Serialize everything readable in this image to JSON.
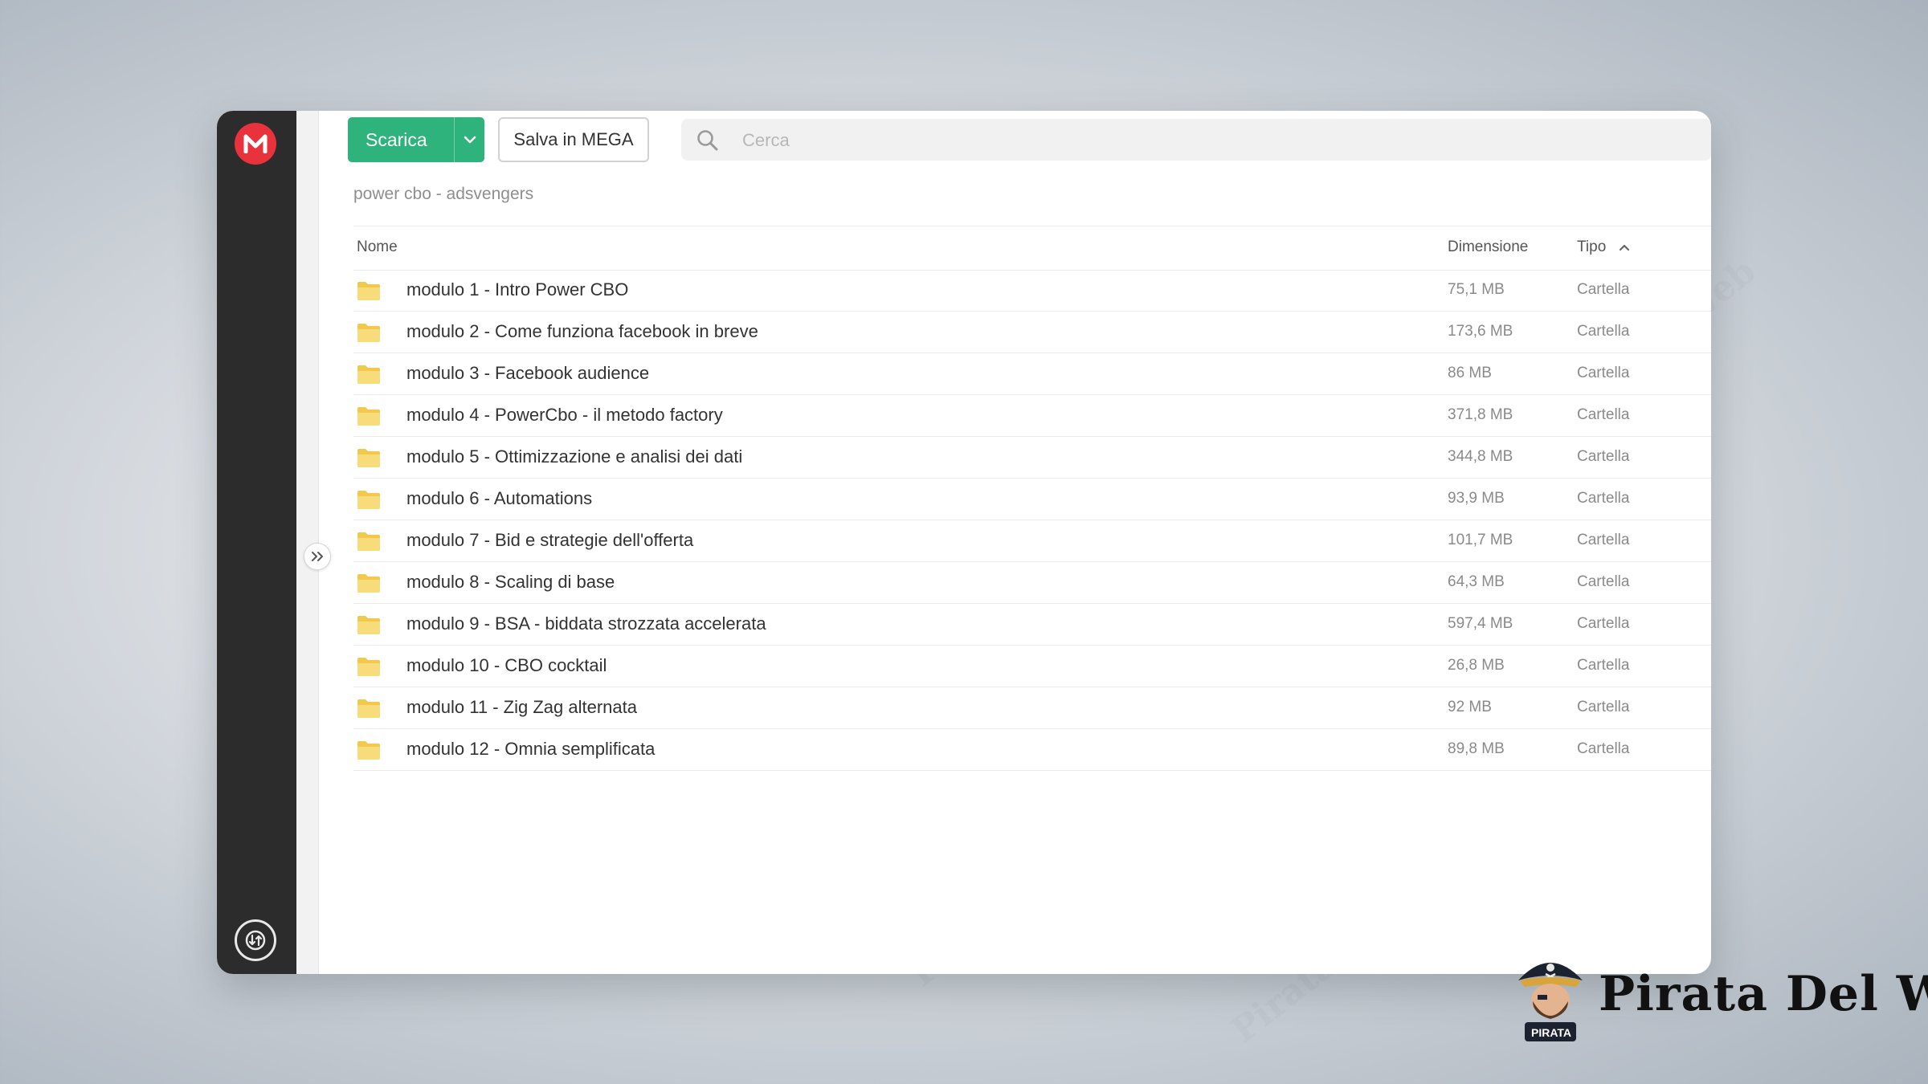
{
  "toolbar": {
    "download_label": "Scarica",
    "save_label": "Salva in MEGA"
  },
  "search": {
    "placeholder": "Cerca"
  },
  "breadcrumb": "power cbo - adsvengers",
  "table": {
    "columns": {
      "name": "Nome",
      "size": "Dimensione",
      "type": "Tipo"
    },
    "rows": [
      {
        "name": "modulo 1 - Intro Power CBO",
        "size": "75,1 MB",
        "type": "Cartella"
      },
      {
        "name": "modulo 2 - Come funziona facebook in breve",
        "size": "173,6 MB",
        "type": "Cartella"
      },
      {
        "name": "modulo 3 - Facebook audience",
        "size": "86 MB",
        "type": "Cartella"
      },
      {
        "name": "modulo 4 - PowerCbo - il metodo factory",
        "size": "371,8 MB",
        "type": "Cartella"
      },
      {
        "name": "modulo 5 - Ottimizzazione e analisi dei dati",
        "size": "344,8 MB",
        "type": "Cartella"
      },
      {
        "name": "modulo 6 - Automations",
        "size": "93,9 MB",
        "type": "Cartella"
      },
      {
        "name": "modulo 7 - Bid e strategie dell'offerta",
        "size": "101,7 MB",
        "type": "Cartella"
      },
      {
        "name": "modulo 8 - Scaling di base",
        "size": "64,3 MB",
        "type": "Cartella"
      },
      {
        "name": "modulo 9 - BSA - biddata strozzata accelerata",
        "size": "597,4 MB",
        "type": "Cartella"
      },
      {
        "name": "modulo 10 - CBO cocktail",
        "size": "26,8 MB",
        "type": "Cartella"
      },
      {
        "name": "modulo 11 - Zig Zag alternata",
        "size": "92 MB",
        "type": "Cartella"
      },
      {
        "name": "modulo 12 - Omnia semplificata",
        "size": "89,8 MB",
        "type": "Cartella"
      }
    ]
  },
  "brand": {
    "name": "Pirata Del Web",
    "badge": "PIRATA"
  },
  "watermark_text": "Pirata Del Web",
  "colors": {
    "accent_green": "#2fb37c",
    "logo_red": "#e8323c",
    "sidebar_dark": "#2c2c2c",
    "folder_yellow": "#f6d55c"
  },
  "icons": {
    "logo": "mega-logo-icon",
    "download_dropdown": "chevron-down-icon",
    "search": "search-icon",
    "sort": "chevron-up-icon",
    "expand": "double-chevron-right-icon",
    "folder": "folder-icon",
    "bottom": "transfer-manager-icon"
  }
}
